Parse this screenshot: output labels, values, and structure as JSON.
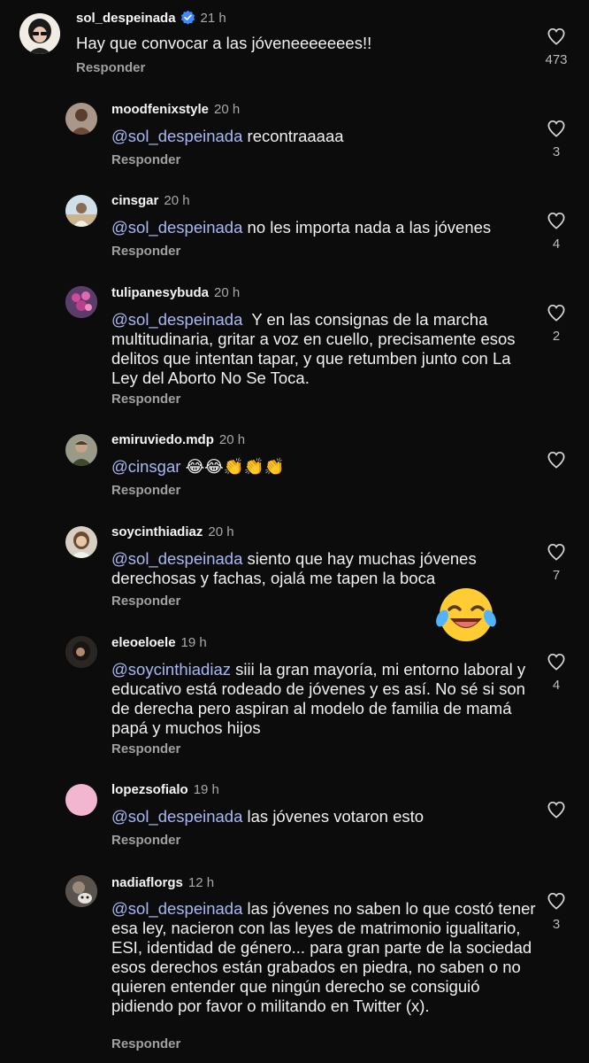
{
  "comments": [
    {
      "username": "sol_despeinada",
      "time": "21 h",
      "mention": "",
      "text": "Hay que convocar a las jóveneeeeeees!!",
      "likes": "473",
      "reply": "Responder",
      "verified": true,
      "avatar_color": "#f1ece4"
    },
    {
      "username": "moodfenixstyle",
      "time": "20 h",
      "mention": "@sol_despeinada",
      "text": "recontraaaaa",
      "likes": "3",
      "reply": "Responder",
      "avatar_color": "#8b6b5c"
    },
    {
      "username": "cinsgar",
      "time": "20 h",
      "mention": "@sol_despeinada",
      "text": "no les importa nada a las jóvenes",
      "likes": "4",
      "reply": "Responder",
      "avatar_color": "#c8b79a"
    },
    {
      "username": "tulipanesybuda",
      "time": "20 h",
      "mention": "@sol_despeinada",
      "text": "Y en las consignas de la marcha multitudinaria, gritar a voz en cuello, precisamente esos delitos que intentan tapar, y que retumben junto con La Ley del Aborto No Se Toca.",
      "likes": "2",
      "reply": "Responder",
      "avatar_color": "#a85a9c"
    },
    {
      "username": "emiruviedo.mdp",
      "time": "20 h",
      "mention": "@cinsgar",
      "text": "😂😂👏👏👏",
      "likes": "",
      "reply": "Responder",
      "avatar_color": "#6b6a58"
    },
    {
      "username": "soycinthiadiaz",
      "time": "20 h",
      "mention": "@sol_despeinada",
      "text": "siento que hay muchas jóvenes derechosas y fachas, ojalá me tapen la boca",
      "likes": "7",
      "reply": "Responder",
      "avatar_color": "#b59a80"
    },
    {
      "username": "eleoeloele",
      "time": "19 h",
      "mention": "@soycinthiadiaz",
      "text": "siii la gran mayoría, mi entorno laboral y educativo está rodeado de jóvenes y es así. No sé si son de derecha pero aspiran al modelo de familia de mamá papá y muchos hijos",
      "likes": "4",
      "reply": "Responder",
      "avatar_color": "#3a3330"
    },
    {
      "username": "lopezsofialo",
      "time": "19 h",
      "mention": "@sol_despeinada",
      "text": "las jóvenes votaron esto",
      "likes": "",
      "reply": "Responder",
      "avatar_color": "#f2b6d0"
    },
    {
      "username": "nadiaflorgs",
      "time": "12 h",
      "mention": "@sol_despeinada",
      "text": "las jóvenes no saben lo que costó tener esa ley, nacieron con las leyes de matrimonio igualitario, ESI, identidad de género... para gran parte de la sociedad esos derechos están grabados en piedra, no saben o no quieren entender que ningún derecho se consiguió pidiendo por favor o militando en Twitter (x).",
      "likes": "3",
      "reply": "Responder",
      "avatar_color": "#7a7068"
    }
  ],
  "floating_emoji": "😂",
  "colors": {
    "background": "#0c0c0c",
    "mention": "#a9b8f5",
    "verified": "#3d8bff"
  }
}
